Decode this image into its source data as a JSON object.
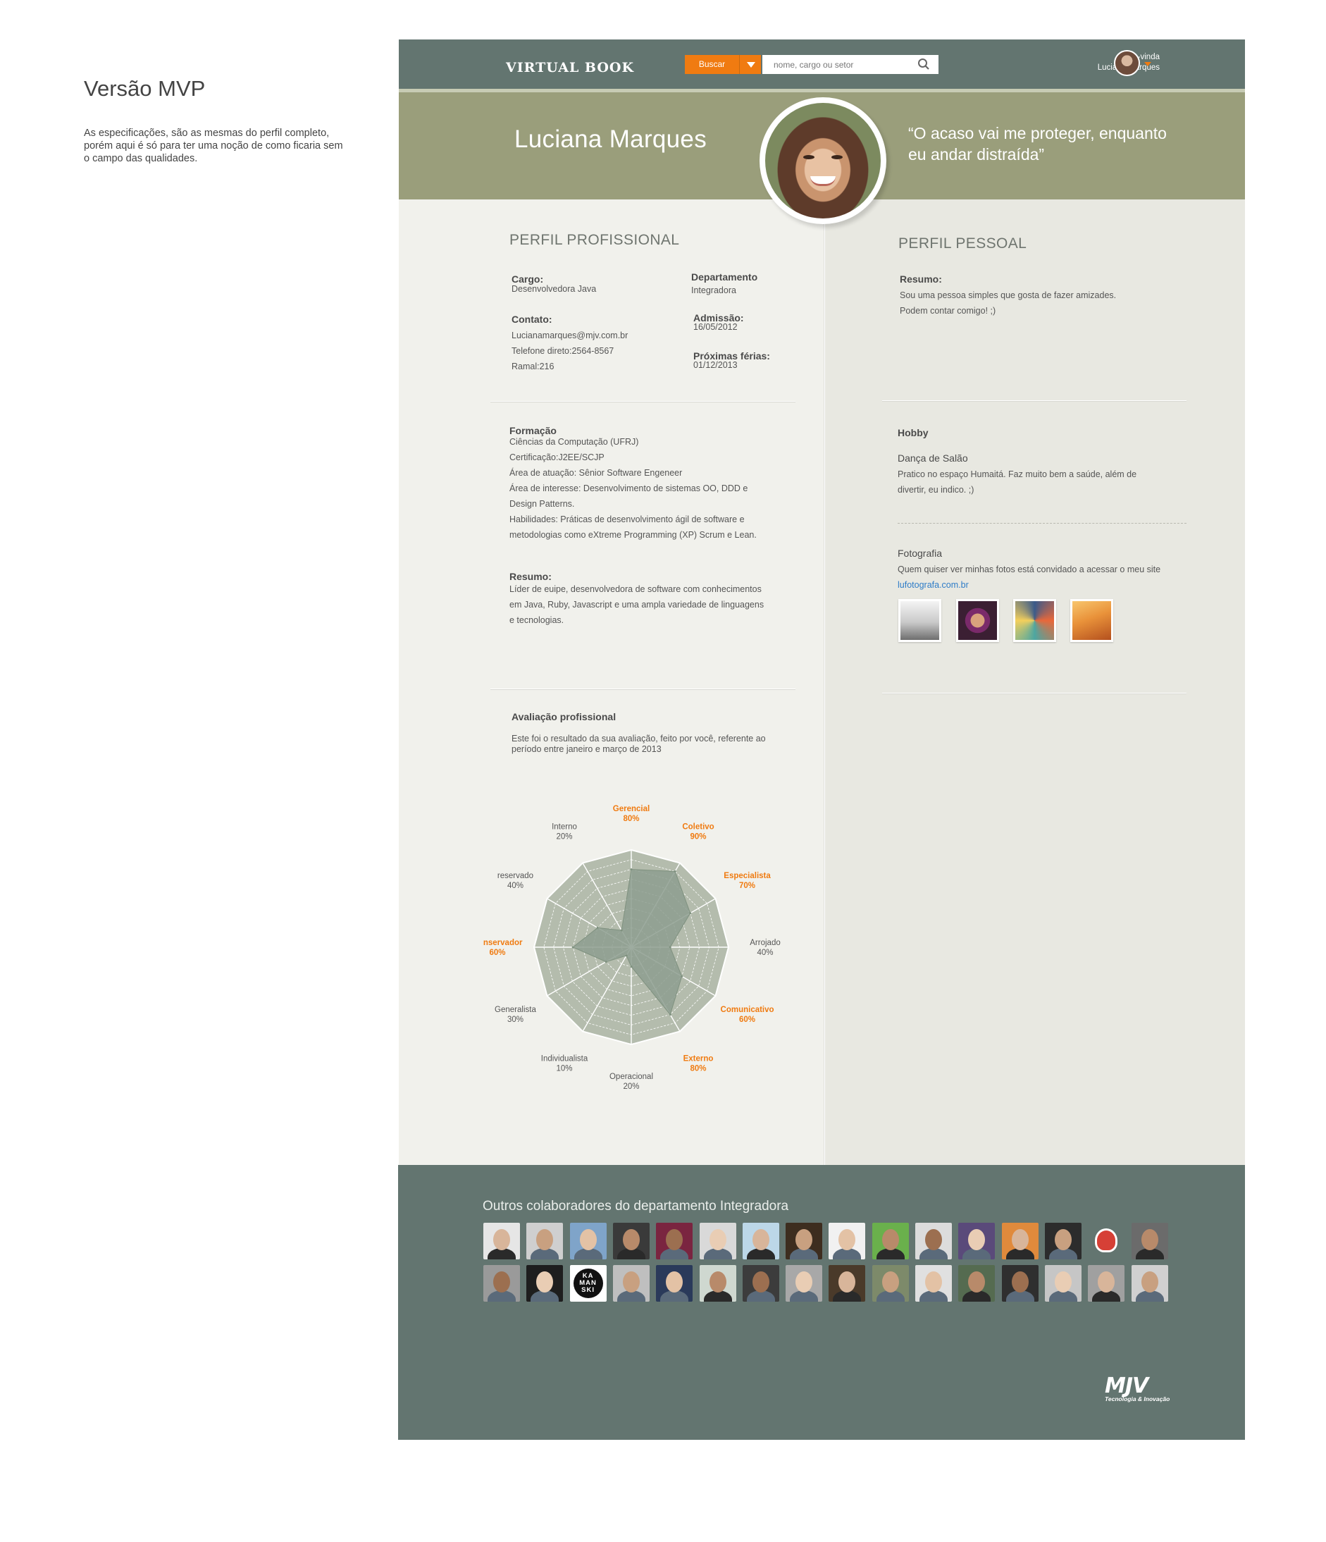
{
  "annotation": {
    "title": "Versão MVP",
    "description": "As especificações, são as mesmas do perfil completo, porém aqui é só para ter uma noção de como ficaria sem o campo das qualidades."
  },
  "header": {
    "brand": "VIRTUAL BOOK",
    "search_button": "Buscar",
    "search_placeholder": "nome, cargo ou setor",
    "welcome_line1": "Bem-vinda",
    "welcome_line2": "Luciana Marques"
  },
  "banner": {
    "name": "Luciana Marques",
    "quote": "“O acaso vai me proteger, enquanto eu andar distraída”"
  },
  "professional": {
    "section_title": "PERFIL PROFISSIONAL",
    "cargo_label": "Cargo:",
    "cargo_value": "Desenvolvedora Java",
    "departamento_label": "Departamento",
    "departamento_value": "Integradora",
    "contato_label": "Contato:",
    "contato_value": "Lucianamarques@mjv.com.br\nTelefone direto:2564-8567\nRamal:216",
    "admissao_label": "Admissão:",
    "admissao_value": "16/05/2012",
    "ferias_label": "Próximas férias:",
    "ferias_value": "01/12/2013",
    "formacao_label": "Formação",
    "formacao_value": "Ciências da Computação (UFRJ)\nCertificação:J2EE/SCJP\nÁrea de atuação: Sênior Software Engeneer\nÁrea de interesse: Desenvolvimento de sistemas OO, DDD e\nDesign Patterns.\nHabilidades: Práticas de desenvolvimento ágil de software e\nmetodologias como eXtreme Programming (XP) Scrum e Lean.",
    "resumo_label": "Resumo:",
    "resumo_value": "Líder de euipe, desenvolvedora de software com conhecimentos\nem Java, Ruby, Javascript e uma ampla variedade de linguagens\ne tecnologias.",
    "avaliacao_label": "Avaliação profissional",
    "avaliacao_value": "Este foi o resultado da sua avaliação, feito por você, referente ao\nperíodo entre janeiro e março de 2013"
  },
  "personal": {
    "section_title": "PERFIL PESSOAL",
    "resumo_label": "Resumo:",
    "resumo_value": "Sou uma pessoa simples que gosta de fazer amizades.\nPodem contar comigo! ;)",
    "hobby_label": "Hobby",
    "hobby1_title": "Dança de Salão",
    "hobby1_text": "Pratico no espaço Humaitá. Faz muito bem a saúde, além de\ndivertir, eu indico. ;)",
    "hobby2_title": "Fotografia",
    "hobby2_text": "Quem quiser ver minhas fotos está convidado a acessar o meu site",
    "hobby2_link": "lufotografa.com.br"
  },
  "chart_data": {
    "type": "radar",
    "title": "",
    "ylim": [
      0,
      100
    ],
    "categories": [
      "Gerencial",
      "Coletivo",
      "Especialista",
      "Arrojado",
      "Comunicativo",
      "Externo",
      "Operacional",
      "Individualista",
      "Generalista",
      "Conservador",
      "reservado",
      "Interno"
    ],
    "values": [
      80,
      90,
      70,
      40,
      60,
      80,
      20,
      10,
      30,
      60,
      40,
      20
    ],
    "value_labels": [
      "80%",
      "90%",
      "70%",
      "40%",
      "60%",
      "80%",
      "20%",
      "10%",
      "30%",
      "60%",
      "40%",
      "20%"
    ],
    "highlighted": [
      true,
      true,
      true,
      false,
      true,
      true,
      false,
      false,
      false,
      true,
      false,
      false
    ],
    "colors": {
      "highlight": "#f07b11",
      "normal": "#555555",
      "grid": "#a9b3a8",
      "area": "#8d9e8f"
    }
  },
  "footer": {
    "title": "Outros colaboradores do departamento Integradora",
    "logo": "MJV",
    "logo_tagline": "Tecnologia & Inovação",
    "badge_text": "KA MAN SKI"
  },
  "colors": {
    "header": "#637570",
    "banner": "#9a9e7b",
    "accent": "#f07b11",
    "link": "#2e7cc7"
  }
}
